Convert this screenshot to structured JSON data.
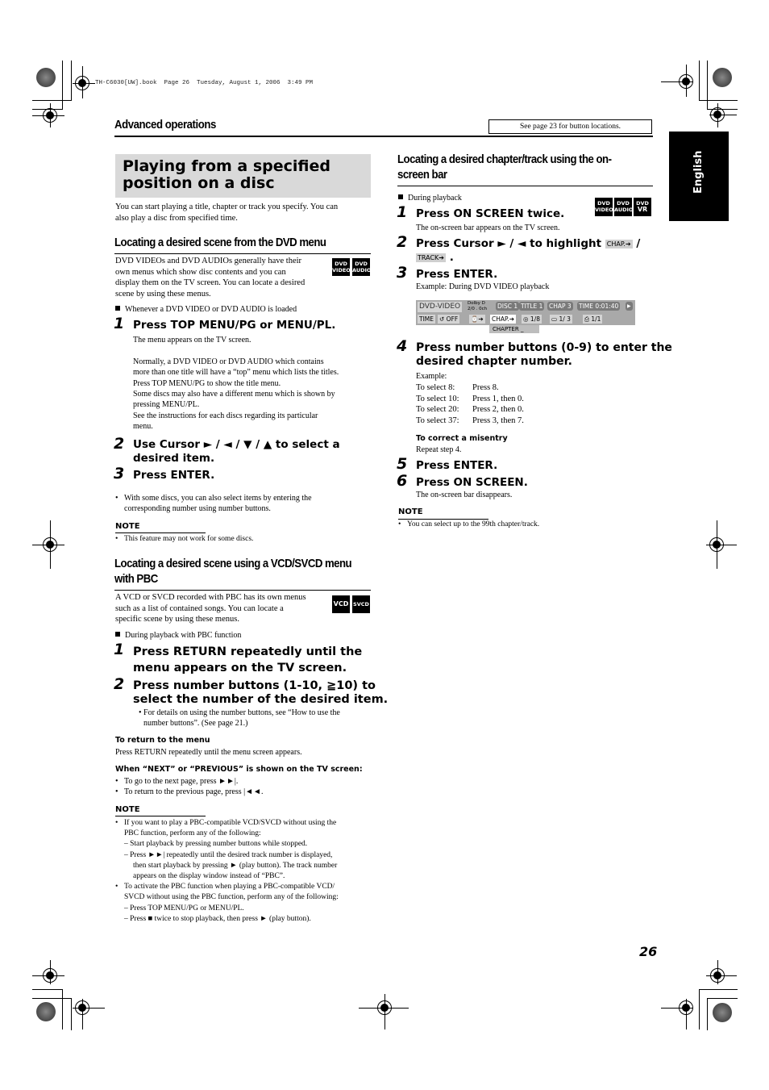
{
  "print_header": "TH-C6030[UW].book  Page 26  Tuesday, August 1, 2006  3:49 PM",
  "running_header": {
    "section": "Advanced operations",
    "see_box": "See page 23 for button locations."
  },
  "language_tab": "English",
  "page_number": "26",
  "left_column": {
    "title": [
      "Playing from a specified",
      "position on a disc"
    ],
    "intro": [
      "You can start playing a title, chapter or track you specify. You can",
      "also play a disc from specified time."
    ],
    "dvd_menu": {
      "heading": "Locating a desired scene from the DVD menu",
      "desc": [
        "DVD VIDEOs and DVD AUDIOs generally have their",
        "own menus which show disc contents and you can",
        "display them on the TV screen. You can locate a desired",
        "scene by using these menus."
      ],
      "badges": [
        {
          "line1": "DVD",
          "line2": "VIDEO"
        },
        {
          "line1": "DVD",
          "line2": "AUDIO"
        }
      ],
      "condition": "Whenever a DVD VIDEO or DVD AUDIO is loaded",
      "steps": [
        {
          "num": "1",
          "text": "Press TOP MENU/PG or MENU/PL.",
          "detail": [
            "The menu appears on the TV screen.",
            "",
            "Normally, a DVD VIDEO or DVD AUDIO which contains",
            "more than one title will have a “top” menu which lists the titles.",
            "Press TOP MENU/PG to show the title menu.",
            "Some discs may also have a different menu which is shown by",
            "pressing MENU/PL.",
            "See the instructions for each discs regarding its particular",
            "menu."
          ]
        },
        {
          "num": "2",
          "text": [
            "Use Cursor ► / ◄ / ▼ / ▲ to select a",
            "desired item."
          ]
        },
        {
          "num": "3",
          "text": "Press ENTER."
        }
      ],
      "bullet": [
        "With some discs, you can also select items by entering the",
        "corresponding number using number buttons."
      ],
      "note_label": "NOTE",
      "note": "This feature may not work for some discs."
    },
    "vcd_menu": {
      "heading": [
        "Locating a desired scene using a VCD/SVCD menu",
        "with PBC"
      ],
      "desc": [
        "A VCD or SVCD recorded with PBC has its own menus",
        "such as a list of contained songs. You can locate a",
        "specific scene by using these menus."
      ],
      "badges": [
        "VCD",
        "SVCD"
      ],
      "condition": "During playback with PBC function",
      "steps": [
        {
          "num": "1",
          "text": [
            "Press RETURN repeatedly until the",
            "menu appears on the TV screen."
          ]
        },
        {
          "num": "2",
          "text": [
            "Press number buttons (1-10, ≧10) to",
            "select the number of the desired item."
          ],
          "detail": [
            "• For details on using the number buttons, see “How to use the",
            "number buttons”. (See page 21.)"
          ]
        }
      ],
      "return_head": "To return to the menu",
      "return_text": "Press RETURN repeatedly until the menu screen appears.",
      "next_head": "When “NEXT” or “PREVIOUS” is shown on the TV screen:",
      "next_bullets": [
        "To go to the next page, press ►►|.",
        "To return to the previous page, press |◄◄."
      ],
      "note_label": "NOTE",
      "notes": [
        "If you want to play a PBC-compatible VCD/SVCD without using the",
        "PBC function, perform any of the following:",
        "–  Start playback by pressing number buttons while stopped.",
        "–  Press ►►| repeatedly until the desired track number is displayed,",
        "then start playback by pressing ► (play button). The track number",
        "appears on the display window instead of “PBC”.",
        "To activate the PBC function when playing a PBC-compatible VCD/",
        "SVCD without using the PBC function, perform any of the following:",
        "–  Press TOP MENU/PG or MENU/PL.",
        "–  Press ■ twice to stop playback, then press ► (play button)."
      ]
    }
  },
  "right_column": {
    "heading": [
      "Locating a desired chapter/track using the on-",
      "screen bar"
    ],
    "condition": "During playback",
    "badges": [
      {
        "line1": "DVD",
        "line2": "VIDEO"
      },
      {
        "line1": "DVD",
        "line2": "AUDIO"
      },
      {
        "line1": "DVD",
        "line2": "VR"
      }
    ],
    "steps": [
      {
        "num": "1",
        "text": "Press ON SCREEN twice.",
        "detail": "The on-screen bar appears on the TV screen."
      },
      {
        "num": "2",
        "text": "Press Cursor ► / ◄ to highlight",
        "chip1": "CHAP.➔",
        "sep": "/",
        "chip2": "TRACK➔",
        "end": "."
      },
      {
        "num": "3",
        "text": "Press ENTER.",
        "detail": "Example: During DVD VIDEO playback"
      },
      {
        "num": "4",
        "text": [
          "Press number buttons (0-9) to enter the",
          "desired chapter number."
        ]
      },
      {
        "num": "5",
        "text": "Press ENTER."
      },
      {
        "num": "6",
        "text": "Press ON SCREEN.",
        "detail": "The on-screen bar disappears."
      }
    ],
    "osd": {
      "mode": "DVD-VIDEO",
      "audio_fmt": [
        "Dolby D",
        "2/0 . 0ch"
      ],
      "disc": "DISC 1",
      "title": "TITLE  1",
      "chap": "CHAP  3",
      "time": "TIME   0:01:40",
      "play": "▶",
      "row2": [
        "TIME",
        "↺ OFF",
        "⌚➔",
        "CHAP.➔",
        "◎ 1/8",
        "▭ 1/  3",
        "⎙ 1/1"
      ],
      "popup": "CHAPTER   _"
    },
    "example_label": "Example:",
    "examples": [
      {
        "select": "To select 8:",
        "press": "Press 8."
      },
      {
        "select": "To select 10:",
        "press": "Press 1, then 0."
      },
      {
        "select": "To select 20:",
        "press": "Press 2, then 0."
      },
      {
        "select": "To select 37:",
        "press": "Press 3, then 7."
      }
    ],
    "misentry_head": "To correct a misentry",
    "misentry_text": "Repeat step 4.",
    "note_label": "NOTE",
    "note": "You can select up to the 99th chapter/track."
  }
}
